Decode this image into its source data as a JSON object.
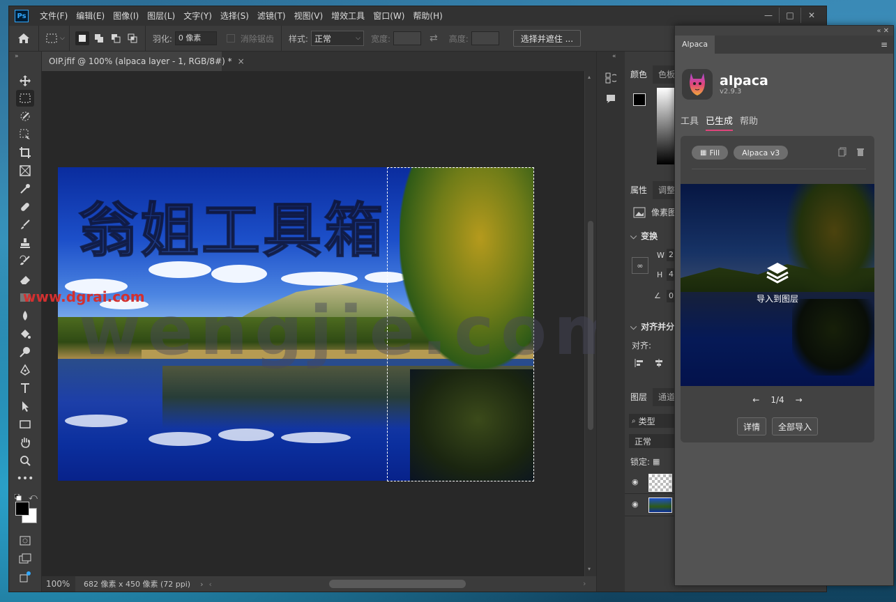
{
  "app": {
    "logo_text": "Ps"
  },
  "menu": [
    "文件(F)",
    "编辑(E)",
    "图像(I)",
    "图层(L)",
    "文字(Y)",
    "选择(S)",
    "滤镜(T)",
    "视图(V)",
    "增效工具",
    "窗口(W)",
    "帮助(H)"
  ],
  "window_controls": {
    "minimize": "—",
    "maximize": "□",
    "close": "✕"
  },
  "options": {
    "feather_label": "羽化:",
    "feather_value": "0 像素",
    "antialias_label": "消除锯齿",
    "style_label": "样式:",
    "style_value": "正常",
    "width_label": "宽度:",
    "height_label": "高度:",
    "select_mask_button": "选择并遮住 ..."
  },
  "document": {
    "tab_title": "OIP.jfif @ 100% (alpaca layer - 1, RGB/8#) *",
    "tab_close": "×",
    "zoom": "100%",
    "size_info": "682 像素 x 450 像素 (72 ppi)"
  },
  "watermark": {
    "line1": "翁姐工具箱",
    "line2": "wengjie.com",
    "url": "www.dgrai.com"
  },
  "panels": {
    "color_tabs": [
      "颜色",
      "色板"
    ],
    "props_tabs": [
      "属性",
      "调整"
    ],
    "pixel_layer_label": "像素图",
    "transform_label": "变换",
    "w_label": "W",
    "w_value": "2",
    "h_label": "H",
    "h_value": "4",
    "angle_value": "0.",
    "align_label": "对齐并分",
    "align_sub_label": "对齐:",
    "layers_tabs": [
      "图层",
      "通道"
    ],
    "filter_kind": "类型",
    "blend_mode": "正常",
    "lock_label": "锁定:"
  },
  "plugin": {
    "tab": "Alpaca",
    "top_controls": "«  ✕",
    "name": "alpaca",
    "version": "v2.9.3",
    "nav": [
      "工具",
      "已生成",
      "帮助"
    ],
    "pills": [
      "Fill",
      "Alpaca v3"
    ],
    "import_label": "导入到图层",
    "page": "1/4",
    "details_button": "详情",
    "import_all_button": "全部导入"
  },
  "colors": {
    "accent_underline": "#e0457b",
    "ps_blue": "#31a8ff"
  }
}
